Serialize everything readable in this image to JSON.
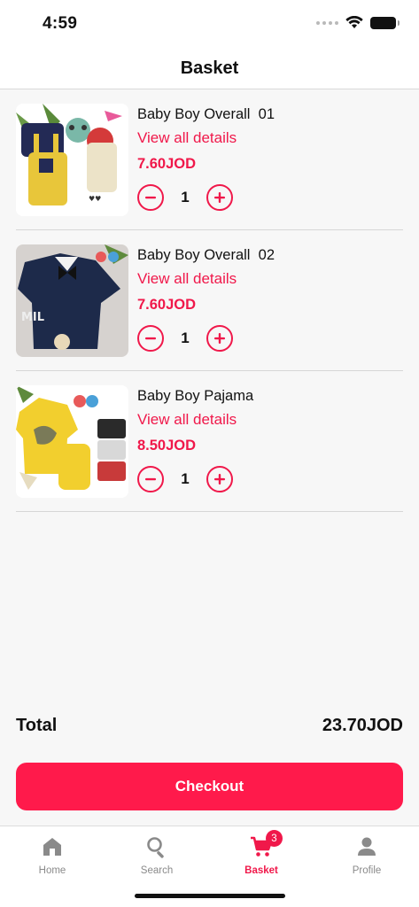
{
  "status_bar": {
    "time": "4:59"
  },
  "header": {
    "title": "Basket"
  },
  "items": [
    {
      "name": "Baby Boy Overall  01",
      "link": "View all details",
      "price": "7.60JOD",
      "quantity": "1",
      "image_icon": "baby-overall-yellow-image"
    },
    {
      "name": "Baby Boy Overall  02",
      "link": "View all details",
      "price": "7.60JOD",
      "quantity": "1",
      "image_icon": "baby-overall-navy-image"
    },
    {
      "name": "Baby Boy Pajama",
      "link": "View all details",
      "price": "8.50JOD",
      "quantity": "1",
      "image_icon": "baby-pajama-yellow-image"
    }
  ],
  "total": {
    "label": "Total",
    "value": "23.70JOD"
  },
  "checkout": {
    "label": "Checkout"
  },
  "tabs": [
    {
      "label": "Home",
      "icon": "home-icon"
    },
    {
      "label": "Search",
      "icon": "search-icon"
    },
    {
      "label": "Basket",
      "icon": "cart-icon",
      "badge": "3",
      "active": true
    },
    {
      "label": "Profile",
      "icon": "person-icon"
    }
  ],
  "colors": {
    "accent": "#f0184a",
    "checkout": "#ff1a4b",
    "background": "#f7f7f7"
  }
}
